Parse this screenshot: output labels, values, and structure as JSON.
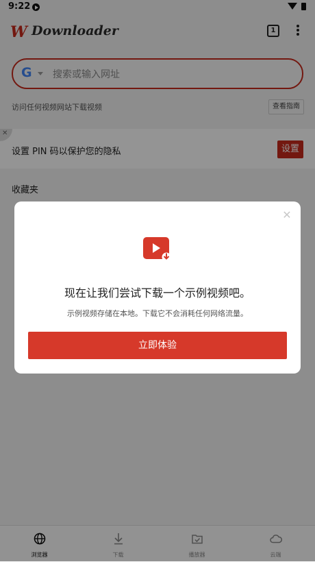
{
  "status_bar": {
    "time": "9:22"
  },
  "app_bar": {
    "logo_mark": "W",
    "logo_text": "Downloader",
    "tab_count": "1"
  },
  "search": {
    "placeholder": "搜索或输入网址",
    "engine_letter": "G"
  },
  "hint": {
    "text": "访问任何视频网站下载视频",
    "guide_label": "查看指南"
  },
  "pin_card": {
    "close_glyph": "✕",
    "text": "设置 PIN 码以保护您的隐私",
    "button_label": "设置"
  },
  "favorites": {
    "title": "收藏夹"
  },
  "bottom_nav": {
    "items": [
      {
        "label": "浏览器",
        "icon": "globe-icon"
      },
      {
        "label": "下载",
        "icon": "download-icon"
      },
      {
        "label": "播放器",
        "icon": "player-icon"
      },
      {
        "label": "云端",
        "icon": "cloud-icon"
      }
    ]
  },
  "dialog": {
    "close_glyph": "✕",
    "title": "现在让我们尝试下载一个示例视频吧。",
    "description": "示例视频存储在本地。下载它不会消耗任何网络流量。",
    "button_label": "立即体验",
    "icon": "video-download-icon"
  },
  "colors": {
    "accent": "#c62a1c",
    "button": "#d6392a"
  }
}
